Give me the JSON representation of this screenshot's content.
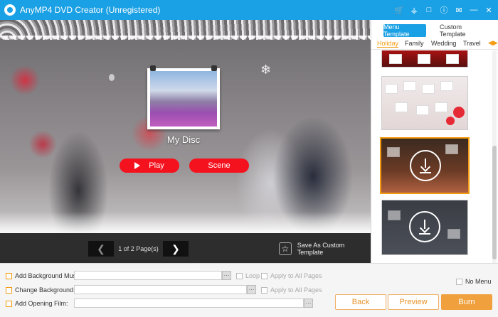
{
  "window": {
    "title": "AnyMP4 DVD Creator (Unregistered)",
    "icons": [
      "cart-icon",
      "key-icon",
      "register-icon",
      "help-icon",
      "feedback-icon",
      "minimize-icon",
      "close-icon"
    ]
  },
  "preview": {
    "disc_title": "My Disc",
    "play_label": "Play",
    "scene_label": "Scene",
    "page_info": "1 of 2 Page(s)",
    "save_template_label": "Save As Custom Template"
  },
  "panel": {
    "tabs": [
      {
        "label": "Menu Template",
        "active": true
      },
      {
        "label": "Custom Template",
        "active": false
      }
    ],
    "categories": [
      "Holiday",
      "Family",
      "Wedding",
      "Travel"
    ],
    "active_category": "Holiday",
    "selected_thumbnail": 3
  },
  "options": {
    "bg_music_label": "Add Background Music:",
    "change_bg_label": "Change Background:",
    "opening_film_label": "Add Opening Film:",
    "loop_label": "Loop",
    "apply_all_label": "Apply to All Pages",
    "no_menu_label": "No Menu",
    "dots": "···"
  },
  "actions": {
    "back_label": "Back",
    "preview_label": "Preview",
    "burn_label": "Burn"
  },
  "colors": {
    "accent": "#1aa0e4",
    "play_button": "#f4121e",
    "orange": "#f39c12",
    "burn": "#f0a03c"
  }
}
